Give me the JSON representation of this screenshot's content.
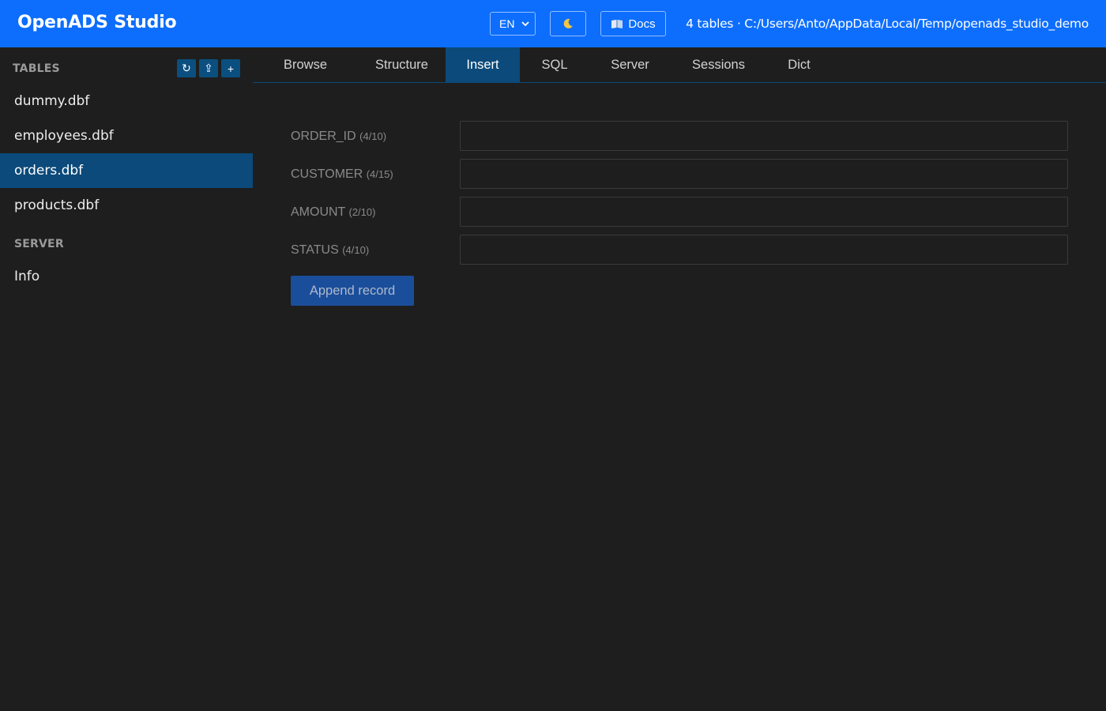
{
  "header": {
    "title": "OpenADS Studio",
    "language": "EN",
    "theme_icon": "moon-icon",
    "docs_icon": "book-icon",
    "docs_label": "Docs",
    "status": "4 tables · C:/Users/Anto/AppData/Local/Temp/openads_studio_demo"
  },
  "sidebar": {
    "tables_label": "TABLES",
    "actions": [
      {
        "icon": "refresh-icon",
        "glyph": "↻"
      },
      {
        "icon": "upload-icon",
        "glyph": "⇪"
      },
      {
        "icon": "plus-icon",
        "glyph": "+"
      }
    ],
    "tables": [
      {
        "label": "dummy.dbf",
        "active": false
      },
      {
        "label": "employees.dbf",
        "active": false
      },
      {
        "label": "orders.dbf",
        "active": true
      },
      {
        "label": "products.dbf",
        "active": false
      }
    ],
    "server_label": "SERVER",
    "server_items": [
      {
        "label": "Info"
      }
    ]
  },
  "tabs": [
    {
      "label": "Browse",
      "active": false
    },
    {
      "label": "Structure",
      "active": false
    },
    {
      "label": "Insert",
      "active": true
    },
    {
      "label": "SQL",
      "active": false
    },
    {
      "label": "Server",
      "active": false
    },
    {
      "label": "Sessions",
      "active": false
    },
    {
      "label": "Dict",
      "active": false
    }
  ],
  "form": {
    "fields": [
      {
        "name": "ORDER_ID",
        "size": "(4/10)",
        "value": ""
      },
      {
        "name": "CUSTOMER",
        "size": "(4/15)",
        "value": ""
      },
      {
        "name": "AMOUNT",
        "size": "(2/10)",
        "value": ""
      },
      {
        "name": "STATUS",
        "size": "(4/10)",
        "value": ""
      }
    ],
    "submit_label": "Append record"
  },
  "colors": {
    "header_bg": "#0d6efd",
    "active_bg": "#0b4a7a",
    "page_bg": "#1e1e1e",
    "button_bg": "#1b4e9a"
  }
}
